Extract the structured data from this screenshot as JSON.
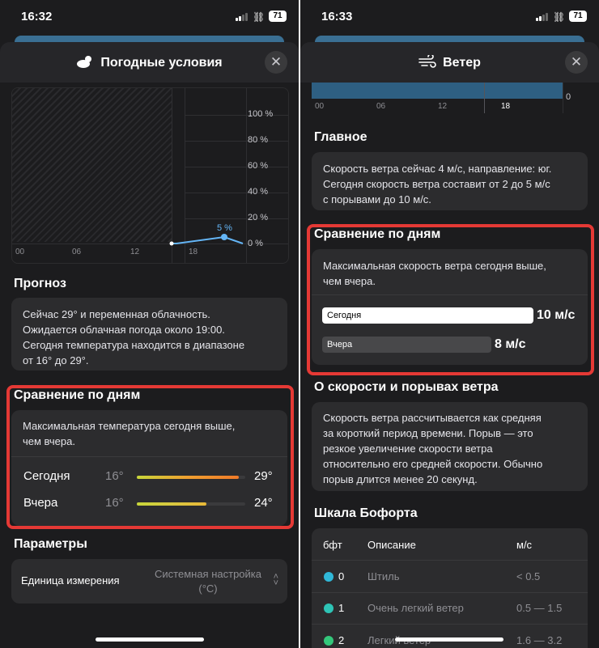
{
  "left": {
    "status": {
      "time": "16:32",
      "battery": "71"
    },
    "title": "Погодные условия",
    "close": "✕",
    "chart": {
      "y_labels": [
        "100 %",
        "80 %",
        "60 %",
        "40 %",
        "20 %",
        "0 %"
      ],
      "x_labels": [
        "00",
        "06",
        "12",
        "18"
      ],
      "point_label": "5 %"
    },
    "forecast": {
      "heading": "Прогноз",
      "text_lines": [
        "Сейчас 29° и переменная облачность.",
        "Ожидается облачная погода около 19:00.",
        "Сегодня температура находится в диапазоне",
        "от 16° до 29°."
      ]
    },
    "compare": {
      "heading": "Сравнение по дням",
      "text_lines": [
        "Максимальная температура сегодня выше,",
        "чем вчера."
      ],
      "today": {
        "label": "Сегодня",
        "min": "16°",
        "max": "29°",
        "fill": 0.94
      },
      "yesterday": {
        "label": "Вчера",
        "min": "16°",
        "max": "24°",
        "fill": 0.64
      }
    },
    "params": {
      "heading": "Параметры",
      "label": "Единица измерения",
      "value_lines": [
        "Системная настройка",
        "(°С)"
      ],
      "chevron": "⌃⌄"
    }
  },
  "right": {
    "status": {
      "time": "16:33",
      "battery": "71"
    },
    "title": "Ветер",
    "close": "✕",
    "chart": {
      "x_labels": [
        "00",
        "06",
        "12",
        "18"
      ],
      "y_label": "0"
    },
    "main": {
      "heading": "Главное",
      "text_lines": [
        "Скорость ветра сейчас 4 м/с, направление: юг.",
        "Сегодня скорость ветра составит от 2 до 5 м/с",
        "с порывами до 10 м/с."
      ]
    },
    "compare": {
      "heading": "Сравнение по дням",
      "text_lines": [
        "Максимальная скорость ветра сегодня выше,",
        "чем вчера."
      ],
      "today": {
        "label": "Сегодня",
        "value": "10 м/с",
        "fill": 1.0
      },
      "yesterday": {
        "label": "Вчера",
        "value": "8 м/с",
        "fill": 0.8
      }
    },
    "about": {
      "heading": "О скорости и порывах ветра",
      "text_lines": [
        "Скорость ветра рассчитывается как средняя",
        "за короткий период времени. Порыв — это",
        "резкое увеличение скорости ветра",
        "относительно его средней скорости. Обычно",
        "порыв длится менее 20 секунд."
      ]
    },
    "beaufort": {
      "heading": "Шкала Бофорта",
      "cols": [
        "бфт",
        "Описание",
        "м/с"
      ],
      "rows": [
        {
          "n": "0",
          "desc": "Штиль",
          "ms": "< 0.5",
          "color": "#30b8d8"
        },
        {
          "n": "1",
          "desc": "Очень легкий ветер",
          "ms": "0.5 — 1.5",
          "color": "#2ec4b6"
        },
        {
          "n": "2",
          "desc": "Легкий ветер",
          "ms": "1.6 — 3.2",
          "color": "#34c77b"
        }
      ]
    }
  },
  "colors": {
    "highlight": "#e53935",
    "point": "#64b5f6",
    "accent_bar": "#3a6f93"
  }
}
